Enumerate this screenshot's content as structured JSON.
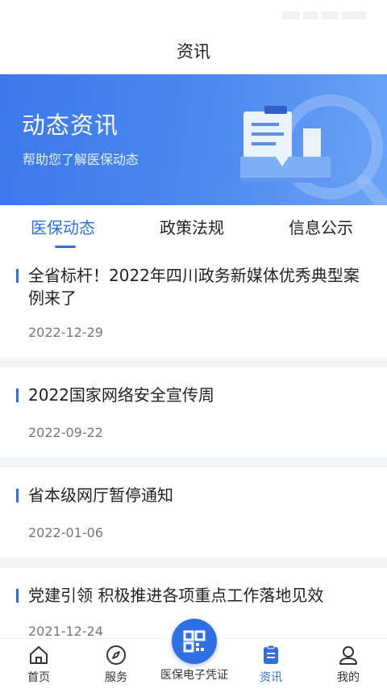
{
  "header": {
    "title": "资讯"
  },
  "banner": {
    "title": "动态资讯",
    "subtitle": "帮助您了解医保动态",
    "illustration_icon": "document-search-icon"
  },
  "tabs": [
    {
      "label": "医保动态",
      "active": true
    },
    {
      "label": "政策法规",
      "active": false
    },
    {
      "label": "信息公示",
      "active": false
    }
  ],
  "news": [
    {
      "title": "全省标杆！2022年四川政务新媒体优秀典型案例来了",
      "date": "2022-12-29"
    },
    {
      "title": "2022国家网络安全宣传周",
      "date": "2022-09-22"
    },
    {
      "title": "省本级网厅暂停通知",
      "date": "2022-01-06"
    },
    {
      "title": "党建引领 积极推进各项重点工作落地见效",
      "date": "2021-12-24"
    }
  ],
  "tabbar": {
    "items": [
      {
        "label": "首页",
        "icon": "home-icon"
      },
      {
        "label": "服务",
        "icon": "compass-icon"
      },
      {
        "label": "医保电子凭证",
        "icon": "qr-code-icon"
      },
      {
        "label": "资讯",
        "icon": "news-icon",
        "active": true
      },
      {
        "label": "我的",
        "icon": "user-icon"
      }
    ]
  },
  "colors": {
    "accent": "#2f6fe6",
    "banner_start": "#3a78ea",
    "banner_end": "#6aa4f6"
  }
}
